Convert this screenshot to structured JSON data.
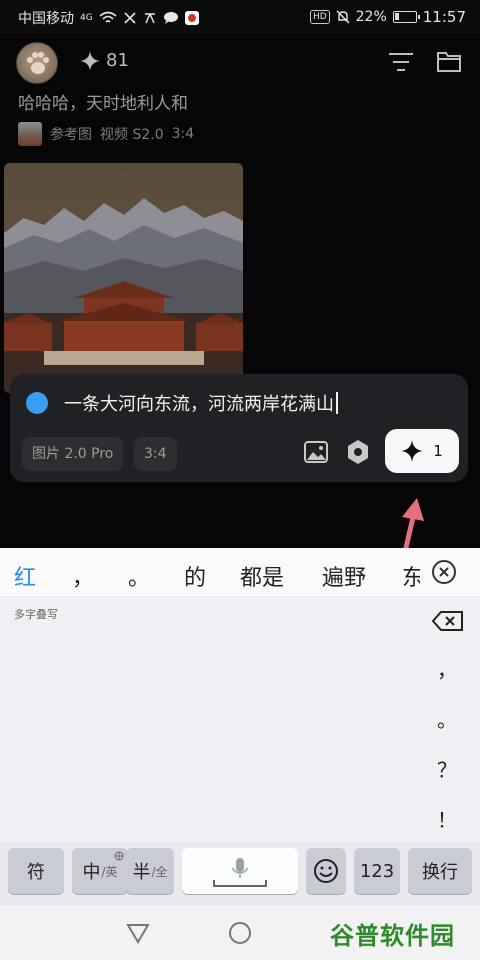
{
  "status_bar": {
    "carrier": "中国移动",
    "network": "4G",
    "hd": "HD",
    "battery_percent": "22%",
    "battery_level": 0.22,
    "time": "11:57"
  },
  "header": {
    "credits": "81",
    "prompt_title": "哈哈哈，天时地利人和",
    "meta_ref_label": "参考图",
    "meta_model": "视频 S2.0",
    "meta_ratio": "3:4"
  },
  "input_card": {
    "text": "一条大河向东流，河流两岸花满山",
    "model_chip": "图片 2.0 Pro",
    "ratio_chip": "3:4",
    "generate_count": "1"
  },
  "keyboard": {
    "candidates": [
      "红",
      "，",
      "。",
      "的",
      "都是",
      "遍野",
      "东"
    ],
    "hint": "多字叠写",
    "side_keys": [
      "，",
      "。",
      "？",
      "！"
    ],
    "keys": {
      "symbol": "符",
      "lang_main": "中",
      "lang_sub": "/英",
      "width_main": "半",
      "width_sub": "/全",
      "numbers": "123",
      "enter": "换行"
    }
  },
  "navbar": {
    "watermark": "谷普软件园"
  },
  "colors": {
    "accent_blue": "#3b9df0",
    "candidate_highlight": "#2c8be8",
    "annotation_arrow": "#e8707e"
  }
}
